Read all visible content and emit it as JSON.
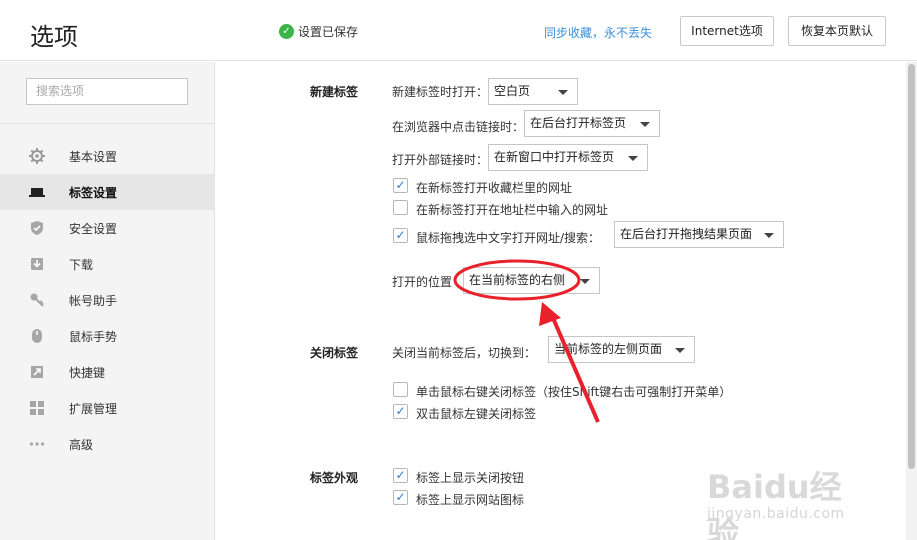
{
  "header": {
    "title": "选项",
    "saved_text": "设置已保存",
    "sync_link": "同步收藏，永不丢失",
    "internet_options_button": "Internet选项",
    "restore_defaults_button": "恢复本页默认"
  },
  "sidebar": {
    "search_placeholder": "搜索选项",
    "items": [
      {
        "label": "基本设置",
        "icon": "gear-icon"
      },
      {
        "label": "标签设置",
        "icon": "laptop-icon"
      },
      {
        "label": "安全设置",
        "icon": "shield-icon"
      },
      {
        "label": "下载",
        "icon": "download-icon"
      },
      {
        "label": "帐号助手",
        "icon": "key-icon"
      },
      {
        "label": "鼠标手势",
        "icon": "mouse-icon"
      },
      {
        "label": "快捷键",
        "icon": "shortcut-arrow-icon"
      },
      {
        "label": "扩展管理",
        "icon": "grid-icon"
      },
      {
        "label": "高级",
        "icon": "more-dots-icon"
      }
    ],
    "active_item": "标签设置"
  },
  "new_tab": {
    "section_title": "新建标签",
    "open_new_tab_label": "新建标签时打开：",
    "open_new_tab_value": "空白页",
    "click_link_label": "在浏览器中点击链接时：",
    "click_link_value": "在后台打开标签页",
    "external_link_label": "打开外部链接时：",
    "external_link_value": "在新窗口中打开标签页",
    "checkboxes": [
      {
        "label": "在新标签打开收藏栏里的网址",
        "checked": true
      },
      {
        "label": "在新标签打开在地址栏中输入的网址",
        "checked": false
      },
      {
        "label": "鼠标拖拽选中文字打开网址/搜索：",
        "checked": true
      }
    ],
    "drag_value": "在后台打开拖拽结果页面",
    "open_position_label": "打开的位置",
    "open_position_value": "在当前标签的右侧"
  },
  "close_tab": {
    "section_title": "关闭标签",
    "after_close_label": "关闭当前标签后，切换到：",
    "after_close_value": "当前标签的左侧页面",
    "checkboxes": [
      {
        "label": "单击鼠标右键关闭标签（按住Shift键右击可强制打开菜单）",
        "checked": false
      },
      {
        "label": "双击鼠标左键关闭标签",
        "checked": true
      }
    ]
  },
  "tab_appearance": {
    "section_title": "标签外观",
    "checkboxes": [
      {
        "label": "标签上显示关闭按钮",
        "checked": true
      },
      {
        "label": "标签上显示网站图标",
        "checked": true
      }
    ]
  },
  "watermark": {
    "logo": "Baidu经验",
    "url": "jingyan.baidu.com"
  },
  "colors": {
    "accent_link": "#3b90d8",
    "saved_check": "#3cb44a",
    "annotation_red": "#e8212b"
  }
}
